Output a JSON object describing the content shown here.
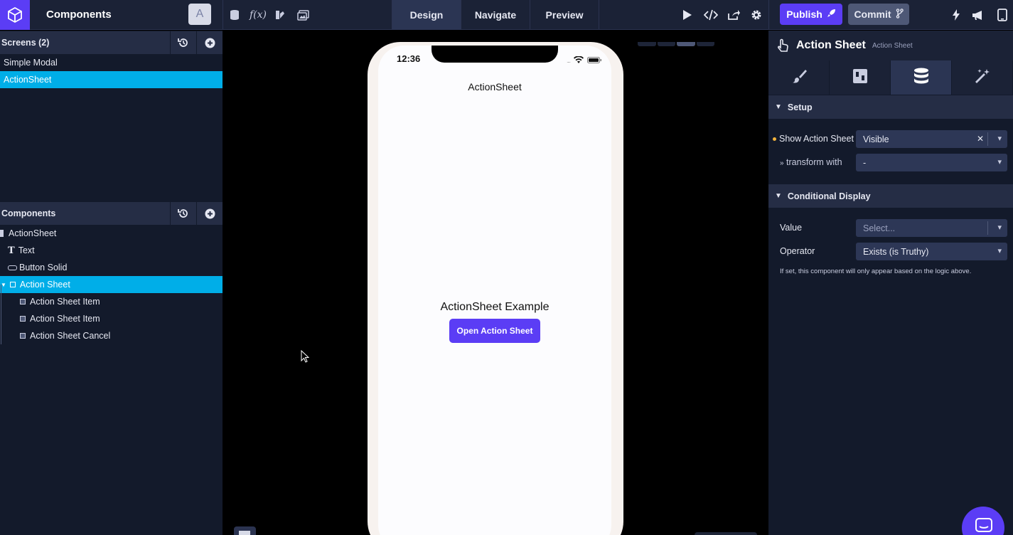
{
  "topbar": {
    "project_title": "Components",
    "avatar_letter": "A",
    "modes": [
      "Design",
      "Navigate",
      "Preview"
    ],
    "active_mode": "Design",
    "publish_label": "Publish",
    "commit_label": "Commit"
  },
  "screens_panel": {
    "title": "Screens (2)",
    "items": [
      {
        "label": "Simple Modal",
        "selected": false
      },
      {
        "label": "ActionSheet",
        "selected": true
      }
    ]
  },
  "components_panel": {
    "title": "Components",
    "tree": [
      {
        "label": "ActionSheet",
        "icon": "screen-icon",
        "depth": 0,
        "selected": false
      },
      {
        "label": "Text",
        "icon": "text-icon",
        "depth": 1,
        "selected": false
      },
      {
        "label": "Button Solid",
        "icon": "button-icon",
        "depth": 1,
        "selected": false
      },
      {
        "label": "Action Sheet",
        "icon": "box-icon",
        "depth": 1,
        "selected": true
      },
      {
        "label": "Action Sheet Item",
        "icon": "box-icon",
        "depth": 2,
        "selected": false
      },
      {
        "label": "Action Sheet Item",
        "icon": "box-icon",
        "depth": 2,
        "selected": false
      },
      {
        "label": "Action Sheet Cancel",
        "icon": "box-icon",
        "depth": 2,
        "selected": false
      }
    ]
  },
  "phone": {
    "clock": "12:36",
    "nav_title": "ActionSheet",
    "example_title": "ActionSheet Example",
    "open_button": "Open Action Sheet"
  },
  "properties": {
    "title": "Action Sheet",
    "subtitle": "Action Sheet",
    "tabs": [
      "style-icon",
      "layout-icon",
      "data-icon",
      "actions-icon"
    ],
    "active_tab": "data-icon",
    "setup": {
      "heading": "Setup",
      "show_label": "Show Action Sheet",
      "show_value": "Visible",
      "transform_label": "transform with",
      "transform_value": "-"
    },
    "conditional": {
      "heading": "Conditional Display",
      "value_label": "Value",
      "value_placeholder": "Select...",
      "operator_label": "Operator",
      "operator_value": "Exists (is Truthy)",
      "help": "If set, this component will only appear based on the logic above."
    }
  },
  "colors": {
    "brand": "#5b3df5",
    "selection": "#00aee8",
    "panel": "#131a2b",
    "header": "#252d45",
    "indicator": "#f3b43c"
  }
}
